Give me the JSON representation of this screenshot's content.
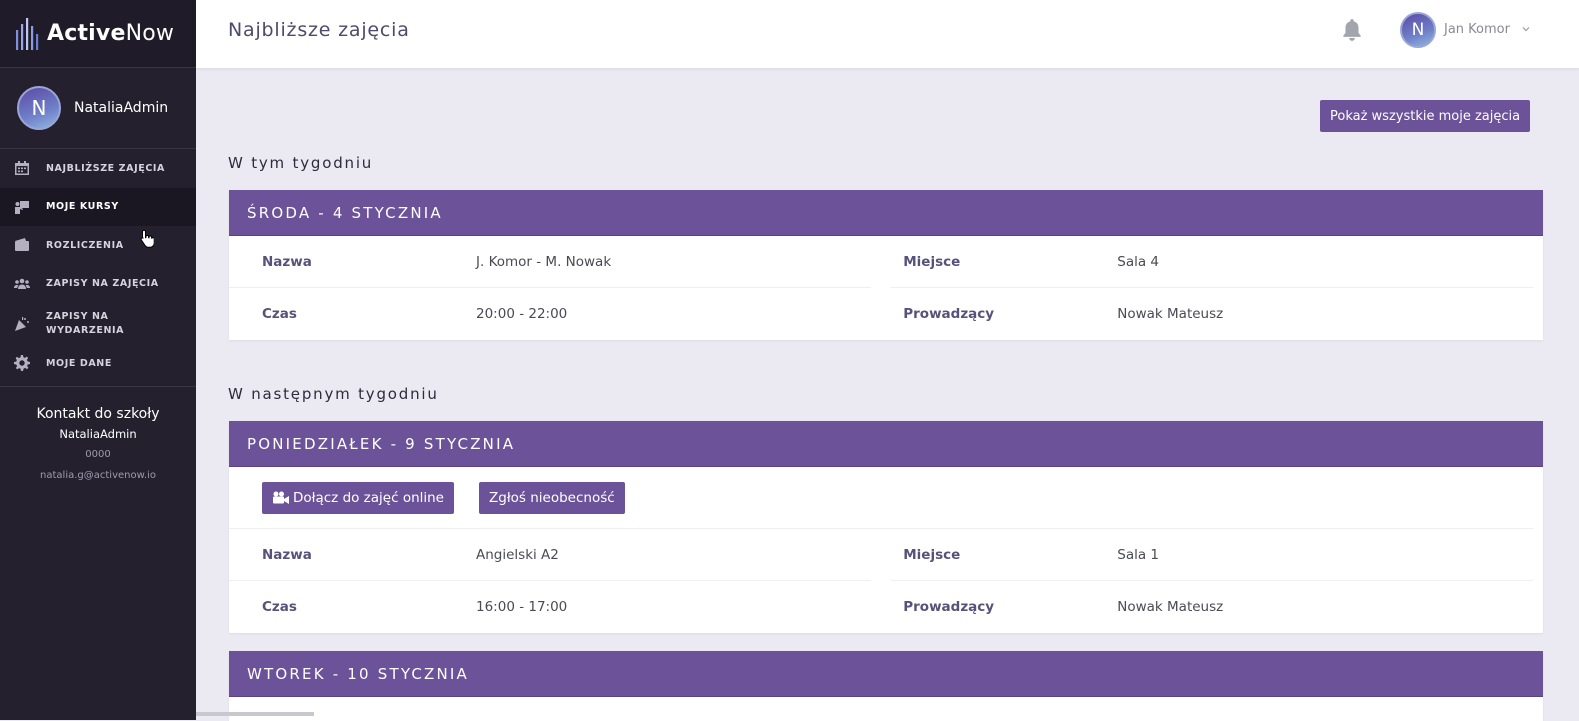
{
  "app": {
    "brand_bold": "Active",
    "brand_light": "Now"
  },
  "sidebar": {
    "profile_initial": "N",
    "profile_name": "NataliaAdmin",
    "items": [
      {
        "label": "NAJBLIŻSZE ZAJĘCIA",
        "icon": "calendar-icon"
      },
      {
        "label": "MOJE KURSY",
        "icon": "teacher-icon"
      },
      {
        "label": "ROZLICZENIA",
        "icon": "wallet-icon"
      },
      {
        "label": "ZAPISY NA ZAJĘCIA",
        "icon": "users-icon"
      },
      {
        "label_line1": "ZAPISY NA",
        "label_line2": "WYDARZENIA",
        "icon": "party-icon"
      },
      {
        "label": "MOJE DANE",
        "icon": "gear-icon"
      }
    ],
    "contact": {
      "title": "Kontakt do szkoły",
      "name": "NataliaAdmin",
      "phone": "0000",
      "email": "natalia.g@activenow.io"
    }
  },
  "header": {
    "title": "Najbliższe zajęcia",
    "user_initial": "N",
    "user_name": "Jan Komor"
  },
  "main": {
    "show_all_label": "Pokaż wszystkie moje zajęcia",
    "this_week_title": "W tym tygodniu",
    "next_week_title": "W następnym tygodniu",
    "labels": {
      "name": "Nazwa",
      "place": "Miejsce",
      "time": "Czas",
      "teacher": "Prowadzący"
    },
    "this_week": [
      {
        "day": "ŚRODA - 4 STYCZNIA",
        "name": "J. Komor - M. Nowak",
        "place": "Sala 4",
        "time": "20:00 - 22:00",
        "teacher": "Nowak Mateusz"
      }
    ],
    "next_week": [
      {
        "day": "PONIEDZIAŁEK - 9 STYCZNIA",
        "join_label": "Dołącz do zajęć online",
        "absence_label": "Zgłoś nieobecność",
        "name": "Angielski A2",
        "place": "Sala 1",
        "time": "16:00 - 17:00",
        "teacher": "Nowak Mateusz"
      },
      {
        "day": "WTOREK - 10 STYCZNIA"
      }
    ]
  },
  "colors": {
    "accent": "#6c5299",
    "sidebar_bg": "#24202e",
    "page_bg": "#ebe9f1"
  }
}
